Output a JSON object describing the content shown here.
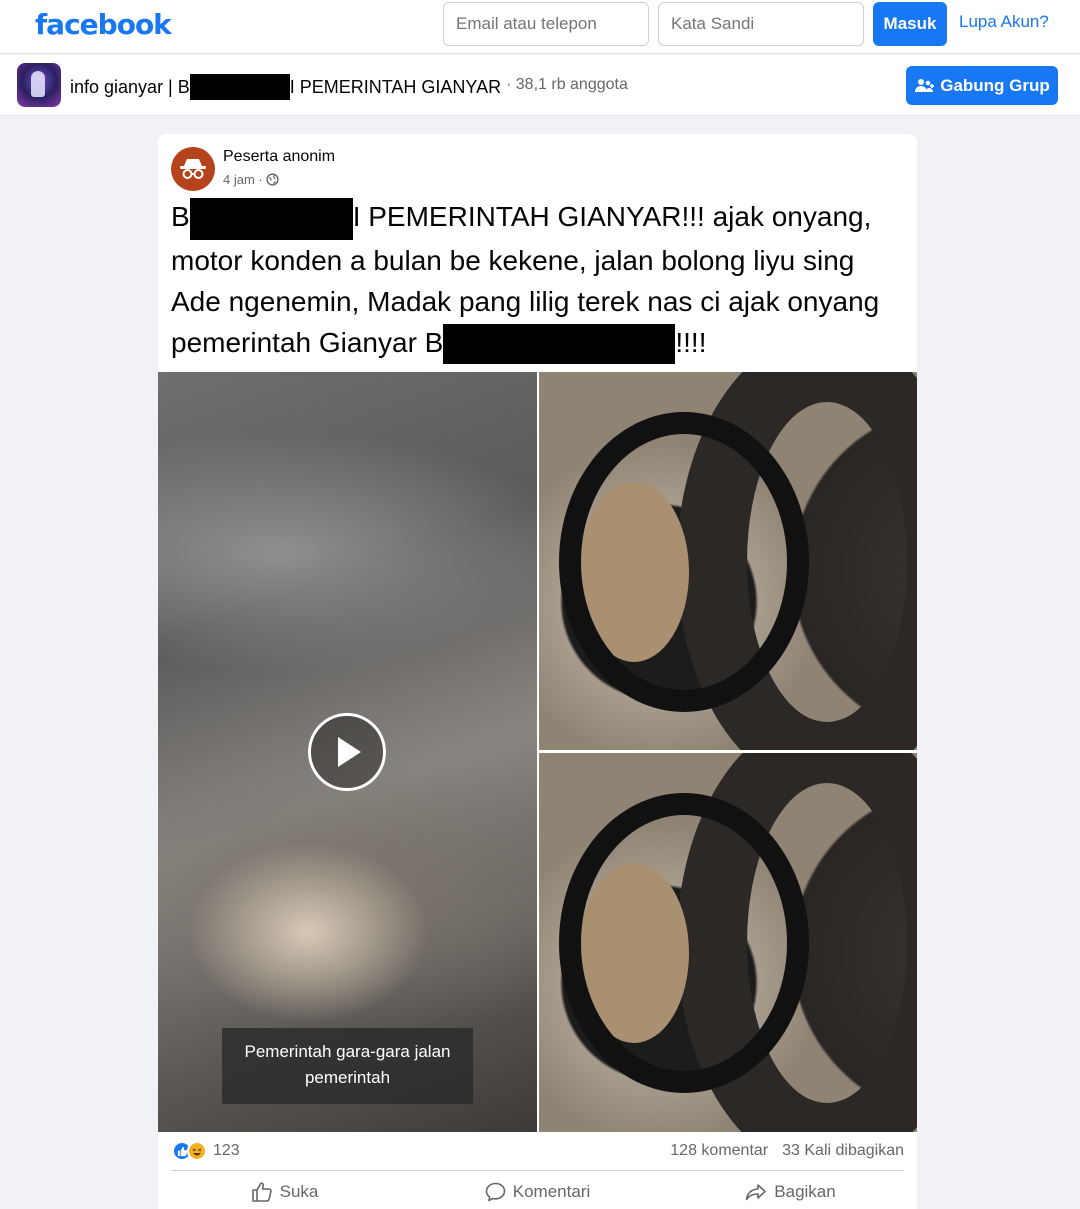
{
  "header": {
    "logo": "facebook",
    "email_placeholder": "Email atau telepon",
    "password_placeholder": "Kata Sandi",
    "login_label": "Masuk",
    "forgot_label": "Lupa Akun?"
  },
  "group": {
    "name_prefix": "info gianyar | B",
    "name_suffix": "I PEMERINTAH GIANYAR",
    "members": "· 38,1 rb anggota",
    "join_label": "Gabung Grup"
  },
  "post": {
    "author": "Peserta anonim",
    "time": "4 jam ·",
    "text_1": "B",
    "text_2": "I PEMERINTAH GIANYAR!!! ajak onyang, motor konden a bulan be kekene, jalan bolong liyu sing Ade ngenemin, Madak pang lilig terek nas ci ajak onyang pemerintah Gianyar B",
    "text_3": "!!!!",
    "video_caption": "Pemerintah gara-gara jalan pemerintah",
    "reaction_count": "123",
    "comments": "128 komentar",
    "shares": "33 Kali dibagikan",
    "actions": {
      "like": "Suka",
      "comment": "Komentari",
      "share": "Bagikan"
    }
  },
  "colors": {
    "brand": "#1877f2",
    "secondary_text": "#65676b",
    "redaction": "#000000"
  }
}
